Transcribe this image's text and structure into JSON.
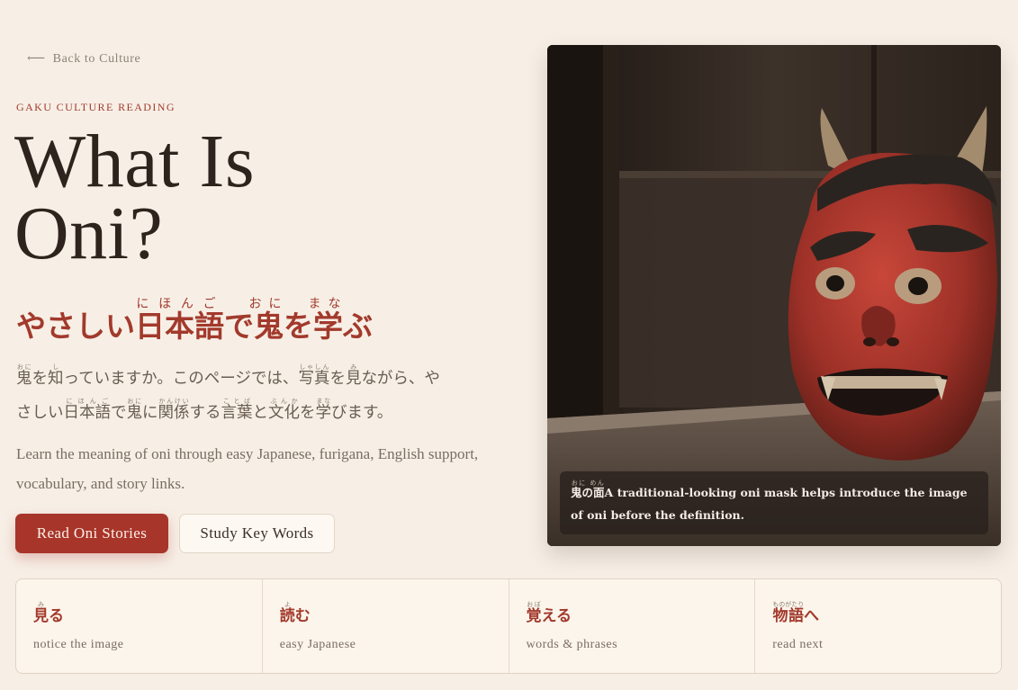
{
  "nav": {
    "back_label": "Back to Culture",
    "back_arrow": "⟵"
  },
  "hero": {
    "eyebrow": "GAKU CULTURE READING",
    "title": "What Is Oni?",
    "jp_title": {
      "pre": "やさしい",
      "w1": "日本語",
      "r1": "にほんご",
      "mid": "で",
      "w2": "鬼",
      "r2": "おに",
      "mid2": "を",
      "w3": "学",
      "r3": "まな",
      "post": "ぶ"
    },
    "jp_body": {
      "line1": {
        "w1": "鬼",
        "r1": "おに",
        "t1": "を",
        "w2": "知",
        "r2": "し",
        "t2": "っていますか。このページでは、",
        "w3": "写真",
        "r3": "しゃしん",
        "t3": "を",
        "w4": "見",
        "r4": "み",
        "t4": "ながら、や"
      },
      "line2": {
        "t0": "さしい",
        "w1": "日本語",
        "r1": "にほんご",
        "t1": "で",
        "w2": "鬼",
        "r2": "おに",
        "t2": "に",
        "w3": "関係",
        "r3": "かんけい",
        "t3": "する",
        "w4": "言葉",
        "r4": "ことば",
        "t4": "と",
        "w5": "文化",
        "r5": "ぶんか",
        "t5": "を",
        "w6": "学",
        "r6": "まな",
        "t6": "びます。"
      }
    },
    "en_body": "Learn the meaning of oni through easy Japanese, furigana, English support, vocabulary, and story links.",
    "primary_button": "Read Oni Stories",
    "secondary_button": "Study Key Words"
  },
  "photo": {
    "caption_jp": "鬼の面",
    "caption_jp_ruby": "おに めん",
    "caption_en": "A traditional-looking oni mask helps introduce the image of oni before the definition."
  },
  "steps": [
    {
      "word": "見",
      "ruby": "み",
      "rest": "る",
      "sub": "notice the image"
    },
    {
      "word": "読",
      "ruby": "よ",
      "rest": "む",
      "sub": "easy Japanese"
    },
    {
      "word": "覚",
      "ruby": "おぼ",
      "rest": "える",
      "sub": "words & phrases"
    },
    {
      "word": "物語",
      "ruby": "ものがたり",
      "rest": "へ",
      "sub": "read next"
    }
  ],
  "colors": {
    "accent": "#a8352a",
    "background": "#f7efe6",
    "text": "#2e241d"
  },
  "icons": {
    "back": "left-arrow-icon"
  }
}
